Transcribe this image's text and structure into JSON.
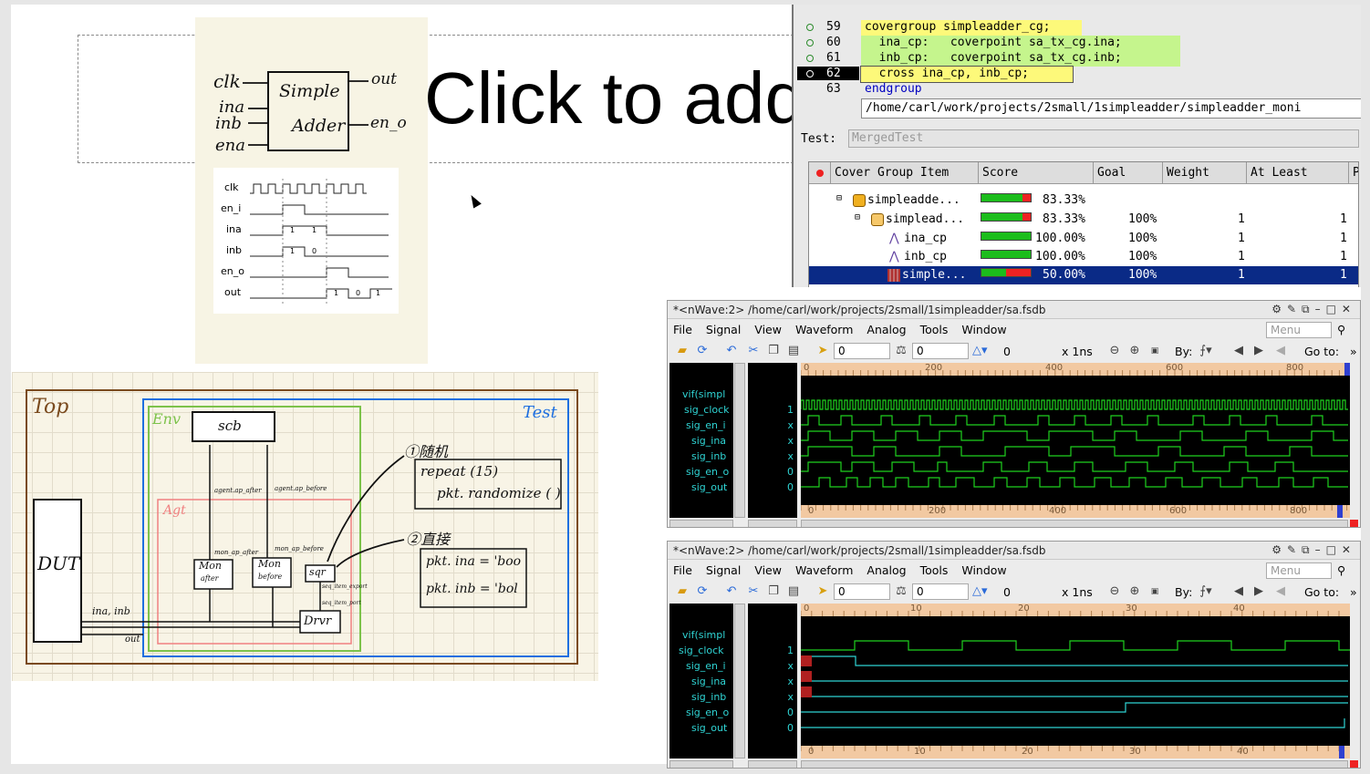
{
  "slide": {
    "title_placeholder": "Click to add"
  },
  "sketch1": {
    "inputs": [
      "clk",
      "ina",
      "inb",
      "ena"
    ],
    "block_line1": "Simple",
    "block_line2": "Adder",
    "outputs": [
      "out",
      "en_o"
    ],
    "timing_signals": [
      "clk",
      "en_i",
      "ina",
      "inb",
      "en_o",
      "out"
    ],
    "ina_vals": [
      "1",
      "1"
    ],
    "inb_vals": [
      "1",
      "0"
    ],
    "out_vals": [
      "1",
      "0",
      "1"
    ]
  },
  "sketch2": {
    "top": "Top",
    "env": "Env",
    "test": "Test",
    "agt": "Agt",
    "scb": "scb",
    "dut": "DUT",
    "mon_after": "Mon",
    "mon_after_sub": "after",
    "mon_before": "Mon",
    "mon_before_sub": "before",
    "sqr": "sqr",
    "drvr": "Drvr",
    "agent_ap_after": "agent.ap_after",
    "agent_ap_before": "agent.ap_before",
    "mon_ap_after": "mon_ap_after",
    "mon_ap_before": "mon_ap_before",
    "seq_item_export": "seq_item_export",
    "seq_item_port": "seq_item_port",
    "ina_inb": "ina, inb",
    "out": "out",
    "note1_title": "①随机",
    "note1_line1": "repeat (15)",
    "note1_line2": "pkt. randomize ( )",
    "note2_title": "②直接",
    "note2_line1": "pkt. ina = 'boo",
    "note2_line2": "pkt. inb = 'bol"
  },
  "coverage": {
    "code_lines": [
      {
        "num": "59",
        "text": "covergroup simpleadder_cg;",
        "highlight": false,
        "bg": "#fdf97a"
      },
      {
        "num": "60",
        "text": "  ina_cp:   coverpoint sa_tx_cg.ina;",
        "highlight": false,
        "bg": "#c5f58d"
      },
      {
        "num": "61",
        "text": "  inb_cp:   coverpoint sa_tx_cg.inb;",
        "highlight": false,
        "bg": "#c5f58d"
      },
      {
        "num": "62",
        "text": "  cross ina_cp, inb_cp;",
        "highlight": true,
        "bg": "#fdf97a"
      },
      {
        "num": "63",
        "text": "endgroup",
        "highlight": false,
        "bg": ""
      }
    ],
    "path": "/home/carl/work/projects/2small/1simpleadder/simpleadder_moni",
    "test_label": "Test:",
    "test_value": "MergedTest",
    "columns": [
      "Cover Group Item",
      "Score",
      "Goal",
      "Weight",
      "At Least",
      "P"
    ],
    "rows": [
      {
        "name": "simpleadde...",
        "score": "83.33%",
        "pct": 0.8333,
        "goal": "",
        "weight": "",
        "atleast": "",
        "icon": "group"
      },
      {
        "name": "simplead...",
        "score": "83.33%",
        "pct": 0.8333,
        "goal": "100%",
        "weight": "1",
        "atleast": "1",
        "icon": "inst"
      },
      {
        "name": "ina_cp",
        "score": "100.00%",
        "pct": 1.0,
        "goal": "100%",
        "weight": "1",
        "atleast": "1",
        "icon": "cp"
      },
      {
        "name": "inb_cp",
        "score": "100.00%",
        "pct": 1.0,
        "goal": "100%",
        "weight": "1",
        "atleast": "1",
        "icon": "cp"
      },
      {
        "name": "simple...",
        "score": "50.00%",
        "pct": 0.5,
        "goal": "100%",
        "weight": "1",
        "atleast": "1",
        "icon": "cross",
        "selected": true
      }
    ]
  },
  "nwave1": {
    "title": "*<nWave:2> /home/carl/work/projects/2small/1simpleadder/sa.fsdb",
    "menu": [
      "File",
      "Signal",
      "View",
      "Waveform",
      "Analog",
      "Tools",
      "Window"
    ],
    "menu_search": "Menu",
    "cursor1": "0",
    "cursor2": "0",
    "delta": "0",
    "scale": "x 1ns",
    "by": "By:",
    "goto": "Go to:",
    "signals": [
      "vif(simpl",
      "sig_clock",
      "sig_en_i",
      "sig_ina",
      "sig_inb",
      "sig_en_o",
      "sig_out"
    ],
    "values": [
      "",
      "1",
      "x",
      "x",
      "x",
      "0",
      "0"
    ],
    "ruler": [
      "0",
      "200",
      "400",
      "600",
      "800"
    ]
  },
  "nwave2": {
    "title": "*<nWave:2> /home/carl/work/projects/2small/1simpleadder/sa.fsdb",
    "menu": [
      "File",
      "Signal",
      "View",
      "Waveform",
      "Analog",
      "Tools",
      "Window"
    ],
    "menu_search": "Menu",
    "cursor1": "0",
    "cursor2": "0",
    "delta": "0",
    "scale": "x 1ns",
    "by": "By:",
    "goto": "Go to:",
    "signals": [
      "vif(simpl",
      "sig_clock",
      "sig_en_i",
      "sig_ina",
      "sig_inb",
      "sig_en_o",
      "sig_out"
    ],
    "values": [
      "",
      "1",
      "x",
      "x",
      "x",
      "0",
      "0"
    ],
    "ruler": [
      "0",
      "10",
      "20",
      "30",
      "40"
    ]
  },
  "colors": {
    "wave_green": "#1fd11f",
    "wave_cyan": "#2fd4d4",
    "selection": "#0a2a86"
  }
}
